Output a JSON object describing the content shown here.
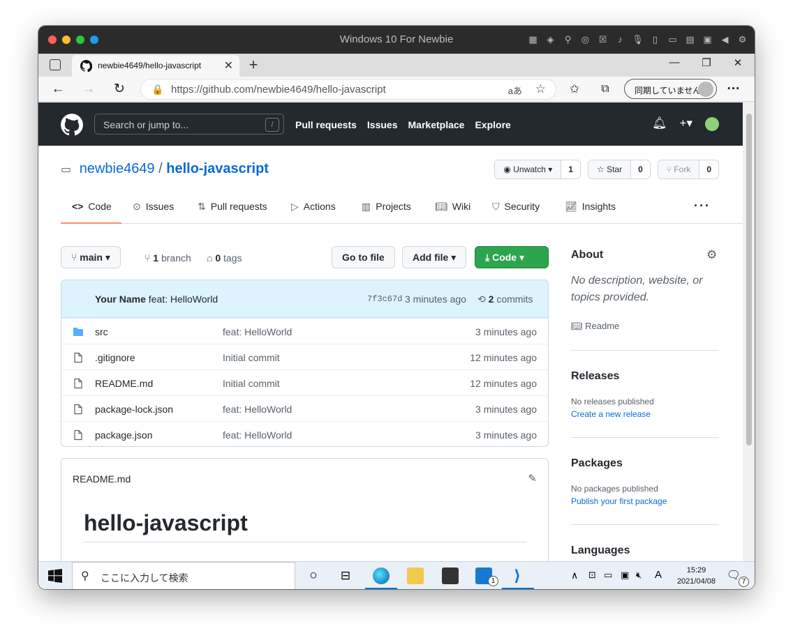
{
  "window": {
    "title": "Windows 10 For Newbie"
  },
  "browser": {
    "tab_title": "newbie4649/hello-javascript",
    "url": "https://github.com/newbie4649/hello-javascript",
    "sync_label": "同期していません"
  },
  "gh_header": {
    "search_placeholder": "Search or jump to...",
    "search_key": "/",
    "nav": [
      "Pull requests",
      "Issues",
      "Marketplace",
      "Explore"
    ]
  },
  "repo": {
    "owner": "newbie4649",
    "name": "hello-javascript",
    "separator": "/",
    "watch": {
      "label": "Unwatch",
      "count": "1"
    },
    "star": {
      "label": "Star",
      "count": "0"
    },
    "fork": {
      "label": "Fork",
      "count": "0"
    },
    "tabs": [
      "Code",
      "Issues",
      "Pull requests",
      "Actions",
      "Projects",
      "Wiki",
      "Security",
      "Insights"
    ],
    "branch_button": "main",
    "branches": {
      "count": "1",
      "label": "branch"
    },
    "tags": {
      "count": "0",
      "label": "tags"
    },
    "goto_file": "Go to file",
    "add_file": "Add file",
    "code_button": "Code",
    "last_commit": {
      "author": "Your Name",
      "message": "feat: HelloWorld",
      "sha": "7f3c67d",
      "time": "3 minutes ago",
      "commits_count": "2",
      "commits_label": "commits"
    },
    "files": [
      {
        "type": "folder",
        "name": "src",
        "message": "feat: HelloWorld",
        "age": "3 minutes ago"
      },
      {
        "type": "file",
        "name": ".gitignore",
        "message": "Initial commit",
        "age": "12 minutes ago"
      },
      {
        "type": "file",
        "name": "README.md",
        "message": "Initial commit",
        "age": "12 minutes ago"
      },
      {
        "type": "file",
        "name": "package-lock.json",
        "message": "feat: HelloWorld",
        "age": "3 minutes ago"
      },
      {
        "type": "file",
        "name": "package.json",
        "message": "feat: HelloWorld",
        "age": "3 minutes ago"
      }
    ],
    "readme": {
      "file_label": "README.md",
      "heading": "hello-javascript"
    }
  },
  "sidebar": {
    "about_title": "About",
    "about_desc": "No description, website, or topics provided.",
    "readme_link": "Readme",
    "releases_title": "Releases",
    "releases_text": "No releases published",
    "releases_link": "Create a new release",
    "packages_title": "Packages",
    "packages_text": "No packages published",
    "packages_link": "Publish your first package",
    "languages_title": "Languages"
  },
  "taskbar": {
    "search_placeholder": "ここに入力して検索",
    "time": "15:29",
    "date": "2021/04/08",
    "ime": "A",
    "mail_badge": "1",
    "notif_badge": "7"
  },
  "colors": {
    "gh_header": "#24292e",
    "link": "#0969da",
    "green": "#2da44e",
    "tab_underline": "#fd8c73"
  }
}
